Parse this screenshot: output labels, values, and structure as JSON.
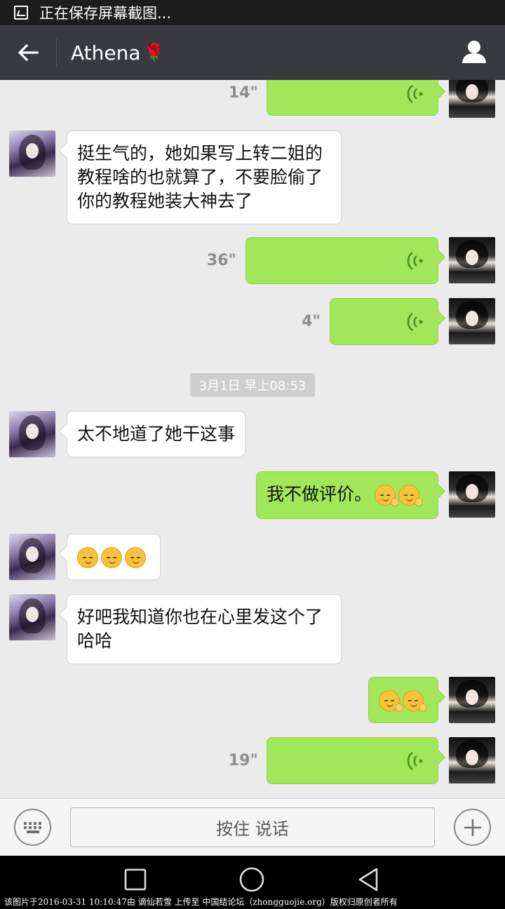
{
  "status_bar": {
    "text": "正在保存屏幕截图..."
  },
  "header": {
    "title": "Athena",
    "back_icon": "arrow-left-icon",
    "profile_icon": "person-icon",
    "title_icon": "rose-icon"
  },
  "messages": [
    {
      "from": "me",
      "type": "voice",
      "duration": "14\""
    },
    {
      "from": "other",
      "type": "text",
      "text": "挺生气的，她如果写上转二姐的教程啥的也就算了，不要脸偷了你的教程她装大神去了"
    },
    {
      "from": "me",
      "type": "voice",
      "duration": "36\""
    },
    {
      "from": "me",
      "type": "voice",
      "duration": "4\""
    },
    {
      "type": "timestamp",
      "text": "3月1日 早上08:53"
    },
    {
      "from": "other",
      "type": "text",
      "text": "太不地道了她干这事"
    },
    {
      "from": "me",
      "type": "text",
      "text": "我不做评价。",
      "emojis": 2
    },
    {
      "from": "other",
      "type": "emoji",
      "emojis": 3
    },
    {
      "from": "other",
      "type": "text",
      "text": "好吧我知道你也在心里发这个了哈哈"
    },
    {
      "from": "me",
      "type": "emoji",
      "emojis": 2
    },
    {
      "from": "me",
      "type": "voice",
      "duration": "19\""
    }
  ],
  "input_bar": {
    "hold_to_talk": "按住 说话",
    "keyboard_icon": "keyboard-icon",
    "plus_icon": "plus-icon"
  },
  "footer": {
    "note": "该图片于2016-03-31 10:10:47由 谪仙若雪 上传至 中国结论坛（zhongguojie.org）版权归原创者所有"
  },
  "colors": {
    "nav_bg": "#393a3f",
    "chat_bg": "#ebebeb",
    "out_bubble": "#a0e75a",
    "in_bubble": "#ffffff"
  }
}
